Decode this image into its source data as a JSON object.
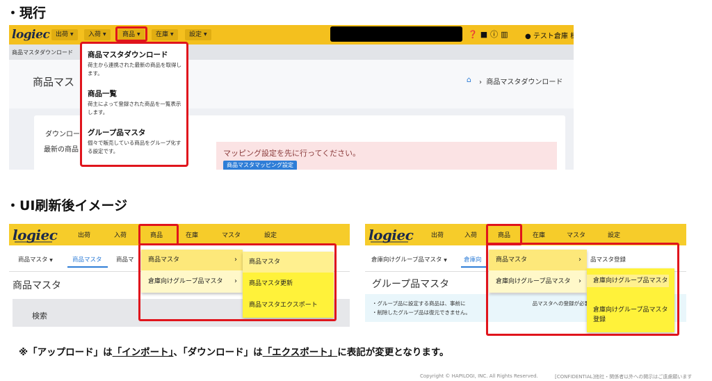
{
  "current": {
    "heading": "・現行",
    "logo": "logiec",
    "menu": [
      "出荷",
      "入荷",
      "商品",
      "在庫",
      "設定"
    ],
    "user": "テスト倉庫 様",
    "breadcrumb_bar": "商品マスタダウンロード",
    "page_title": "商品マス",
    "breadcrumb": "商品マスタダウンロード",
    "card_heading": "ダウンロー",
    "card_sub": "最新の商品",
    "alert_message": "マッピング設定を先に行ってください。",
    "alert_button": "商品マスタマッピング設定",
    "dropdown": [
      {
        "name": "商品マスタダウンロード",
        "desc": "荷主から連携された最新の商品を取得します。"
      },
      {
        "name": "商品一覧",
        "desc": "荷主によって登録された商品を一覧表示します。"
      },
      {
        "name": "グループ品マスタ",
        "desc": "個々で販売している商品をグループ化する設定です。"
      }
    ]
  },
  "new_ui": {
    "heading": "・UI刷新後イメージ",
    "left": {
      "logo": "logiec",
      "menu": [
        "出荷",
        "入荷",
        "商品",
        "在庫",
        "マスタ",
        "設定"
      ],
      "subnav": [
        "商品マスタ",
        "商品マスタ",
        "商品マ"
      ],
      "title": "商品マスタ",
      "search_label": "検索",
      "dropdown1": [
        "商品マスタ",
        "倉庫向けグループ品マスタ"
      ],
      "dropdown2": [
        "商品マスタ",
        "商品マスタ更新",
        "商品マスタエクスポート"
      ]
    },
    "right": {
      "logo": "logiec",
      "menu": [
        "出荷",
        "入荷",
        "商品",
        "在庫",
        "マスタ",
        "設定"
      ],
      "subnav": [
        "倉庫向けグループ品マスタ",
        "倉庫向",
        "品マスタ登録"
      ],
      "title": "グループ品マスタ",
      "info_lines": [
        "・グループ品に設定する商品は、事前に",
        "品マスタへの登録が必要です。",
        "・削除したグループ品は復元できません。"
      ],
      "dropdown1": [
        "商品マスタ",
        "倉庫向けグループ品マスタ"
      ],
      "dropdown2": [
        "倉庫向けグループ品マスタ",
        "倉庫向けグループ品マスタ登録"
      ]
    }
  },
  "note": {
    "prefix": "※「アップロード」は",
    "term1": "「インポート」",
    "middle": "、「ダウンロード」は",
    "term2": "「エクスポート」",
    "suffix": "に表記が変更となります。"
  },
  "footer": {
    "copyright": "Copyright © HAPILOGI, INC. All Rights Reserved.",
    "confidential": "[CONFIDENTIAL]他社・関係者以外への開示はご遠慮願います"
  },
  "colors": {
    "accent_yellow": "#f4c01e",
    "highlight_red": "#e0141c",
    "link_blue": "#2e7dd7"
  }
}
